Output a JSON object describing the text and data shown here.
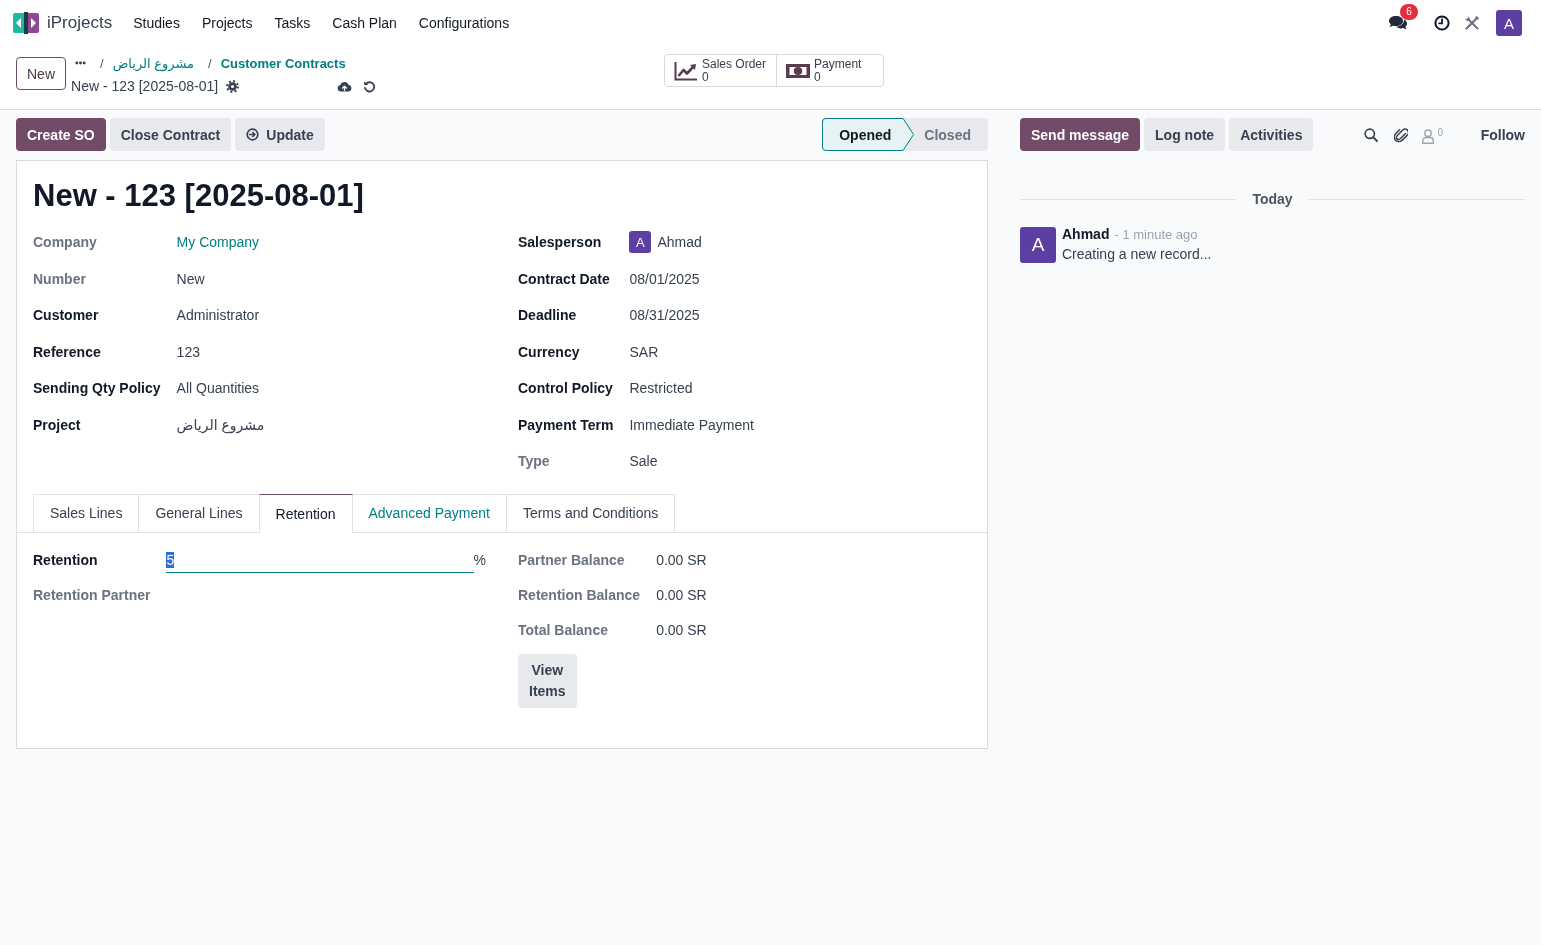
{
  "navbar": {
    "app_name": "iProjects",
    "menu": [
      "Studies",
      "Projects",
      "Tasks",
      "Cash Plan",
      "Configurations"
    ],
    "messages_badge": "6",
    "user_avatar": "A"
  },
  "control_panel": {
    "new_button": "New",
    "breadcrumbs": [
      {
        "separator": "/",
        "label": "مشروع الرياض",
        "kind": "link"
      },
      {
        "separator": "/",
        "label": "Customer Contracts",
        "kind": "strong"
      }
    ],
    "record_title": "New - 123 [2025-08-01]",
    "smart_buttons": [
      {
        "kind": "sales",
        "label": "Sales Order",
        "count": "0"
      },
      {
        "kind": "payment",
        "label": "Payment",
        "count": "0"
      }
    ]
  },
  "status_bar": {
    "buttons": [
      {
        "label": "Create SO",
        "kind": "primary"
      },
      {
        "label": "Close Contract",
        "kind": "secondary"
      },
      {
        "label": "Update",
        "kind": "refresh"
      }
    ],
    "stages": [
      {
        "label": "Opened",
        "selected": true
      },
      {
        "label": "Closed",
        "selected": false
      }
    ]
  },
  "sheet": {
    "title": "New - 123 [2025-08-01]",
    "groups": [
      {
        "fields": [
          {
            "label": "Company",
            "value": "My Company",
            "kind": "link",
            "readonly": true
          },
          {
            "label": "Number",
            "value": "New",
            "kind": "text",
            "readonly": true
          },
          {
            "label": "Customer",
            "value": "Administrator",
            "kind": "text",
            "readonly": false
          },
          {
            "label": "Reference",
            "value": "123",
            "kind": "text",
            "readonly": false
          },
          {
            "label": "Sending Qty Policy",
            "value": "All Quantities",
            "kind": "text",
            "readonly": false
          },
          {
            "label": "Project",
            "value": "مشروع الرياض",
            "kind": "text",
            "readonly": false
          }
        ]
      },
      {
        "fields": [
          {
            "label": "Salesperson",
            "value": "Ahmad",
            "avatar": "A",
            "kind": "avatar",
            "readonly": false
          },
          {
            "label": "Contract Date",
            "value": "08/01/2025",
            "kind": "text",
            "readonly": false
          },
          {
            "label": "Deadline",
            "value": "08/31/2025",
            "kind": "text",
            "readonly": false
          },
          {
            "label": "Currency",
            "value": "SAR",
            "kind": "text",
            "readonly": false
          },
          {
            "label": "Control Policy",
            "value": "Restricted",
            "kind": "text",
            "readonly": false
          },
          {
            "label": "Payment Term",
            "value": "Immediate Payment",
            "kind": "text",
            "readonly": false
          },
          {
            "label": "Type",
            "value": "Sale",
            "kind": "text",
            "readonly": true
          }
        ]
      }
    ],
    "tabs": [
      {
        "label": "Sales Lines",
        "selected": false,
        "hovered": false
      },
      {
        "label": "General Lines",
        "selected": false,
        "hovered": false
      },
      {
        "label": "Retention",
        "selected": true,
        "hovered": false
      },
      {
        "label": "Advanced Payment",
        "selected": false,
        "hovered": true
      },
      {
        "label": "Terms and Conditions",
        "selected": false,
        "hovered": false
      }
    ],
    "tab_content": {
      "groups": [
        {
          "fields": [
            {
              "label": "Retention",
              "value": "5",
              "suffix": "%",
              "text_selected": true,
              "kind": "input",
              "readonly": false
            },
            {
              "label": "Retention Partner",
              "kind": "text",
              "readonly": true
            }
          ]
        },
        {
          "fields": [
            {
              "label": "Partner Balance",
              "value": "0.00 SR",
              "kind": "text",
              "readonly": true
            },
            {
              "label": "Retention Balance",
              "value": "0.00 SR",
              "kind": "text",
              "readonly": true
            },
            {
              "label": "Total Balance",
              "value": "0.00 SR",
              "kind": "text",
              "readonly": true
            }
          ],
          "button": "View Items"
        }
      ]
    }
  },
  "chatter": {
    "buttons": [
      {
        "label": "Send message",
        "kind": "primary"
      },
      {
        "label": "Log note",
        "kind": "secondary"
      },
      {
        "label": "Activities",
        "kind": "secondary"
      }
    ],
    "followers_count": "0",
    "follow": "Follow",
    "divider": "Today",
    "messages": [
      {
        "avatar": "A",
        "author": "Ahmad",
        "time": "- 1 minute ago",
        "body": "Creating a new record..."
      }
    ]
  }
}
